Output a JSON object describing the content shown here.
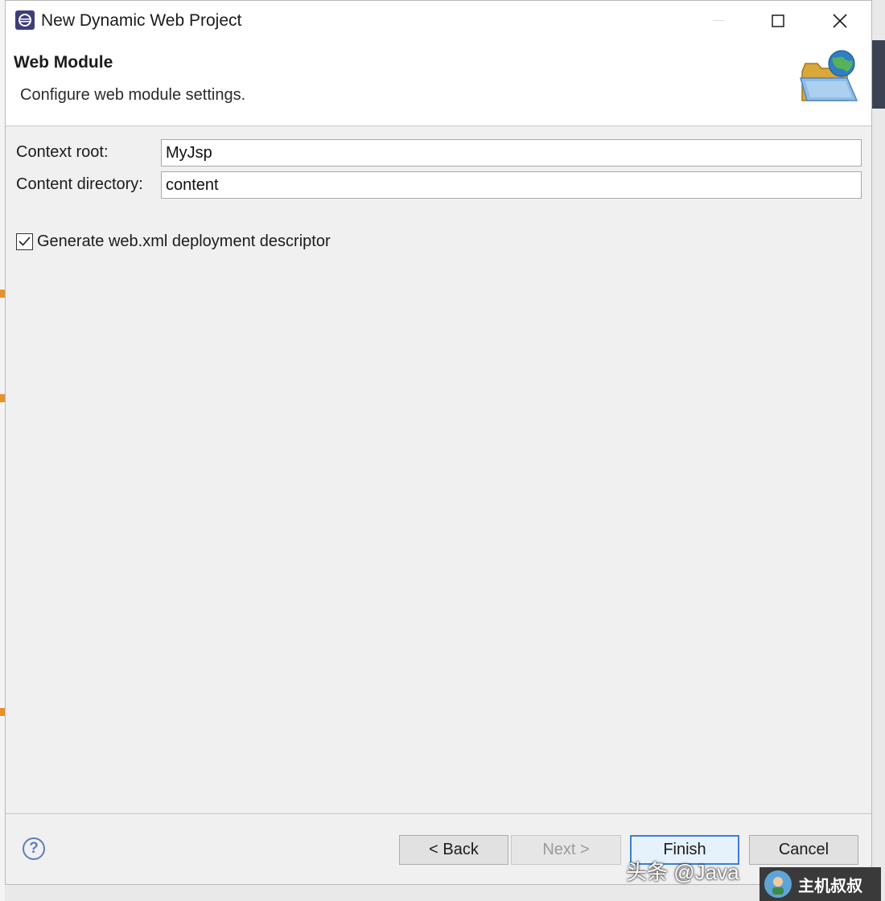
{
  "window": {
    "title": "New Dynamic Web Project"
  },
  "header": {
    "title": "Web Module",
    "description": "Configure web module settings."
  },
  "form": {
    "context_root": {
      "label": "Context root:",
      "value": "MyJsp"
    },
    "content_directory": {
      "label": "Content directory:",
      "value": "content"
    }
  },
  "options": {
    "generate_web_xml": {
      "label": "Generate web.xml deployment descriptor",
      "checked": true
    }
  },
  "footer": {
    "help_label": "?",
    "back_label": "< Back",
    "next_label": "Next >",
    "finish_label": "Finish",
    "cancel_label": "Cancel"
  },
  "watermark": {
    "text": "头条 @Java",
    "badge_text": "主机叔叔"
  },
  "colors": {
    "accent": "#3c7fd1",
    "help": "#5a7fb8",
    "eclipse_icon": "#3d3f78"
  },
  "icons": {
    "app": "eclipse-icon",
    "header": "web-folder-globe-icon",
    "minimize": "minimize-icon",
    "maximize": "maximize-icon",
    "close": "close-icon",
    "check": "checkmark-icon",
    "help": "help-icon"
  }
}
